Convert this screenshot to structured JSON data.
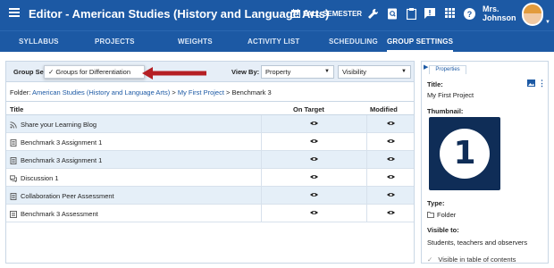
{
  "header": {
    "title": "Editor - American Studies (History and Language Arts)",
    "semester": "FALL SEMESTER",
    "user_line1": "Mrs.",
    "user_line2": "Johnson"
  },
  "nav": {
    "tabs": [
      "SYLLABUS",
      "PROJECTS",
      "WEIGHTS",
      "ACTIVITY LIST",
      "SCHEDULING",
      "GROUP SETTINGS"
    ],
    "active": "GROUP SETTINGS"
  },
  "toolbar": {
    "group_label": "Group Se",
    "group_value": "✓ Groups for Differentiation",
    "view_by_label": "View By:",
    "view_by_value": "Property",
    "visibility_value": "Visibility"
  },
  "breadcrumb": {
    "prefix": "Folder:",
    "course": "American Studies (History and Language Arts)",
    "sep1": " > ",
    "project": "My First Project",
    "sep2": " > ",
    "current": "Benchmark 3"
  },
  "table": {
    "columns": [
      "Title",
      "On Target",
      "Modified"
    ],
    "rows": [
      {
        "title": "Share your Learning Blog",
        "icon": "blog-icon"
      },
      {
        "title": "Benchmark 3 Assignment 1",
        "icon": "assignment-icon"
      },
      {
        "title": "Benchmark 3 Assignment 1",
        "icon": "assignment-icon"
      },
      {
        "title": "Discussion 1",
        "icon": "discussion-icon"
      },
      {
        "title": "Collaboration Peer Assessment",
        "icon": "assignment-icon"
      },
      {
        "title": "Benchmark 3 Assessment",
        "icon": "assessment-icon"
      }
    ]
  },
  "properties": {
    "tab_label": "Properties",
    "title_label": "Title:",
    "title_value": "My First Project",
    "thumbnail_label": "Thumbnail:",
    "thumbnail_number": "1",
    "type_label": "Type:",
    "type_value": "Folder",
    "visible_label": "Visible to:",
    "visible_value": "Students, teachers and observers",
    "toc_label": "Visible in table of contents"
  },
  "colors": {
    "header_bg": "#1c59a4",
    "row_alt": "#e5eff8",
    "arrow_red": "#b51f24",
    "thumb_bg": "#0f2d57"
  }
}
